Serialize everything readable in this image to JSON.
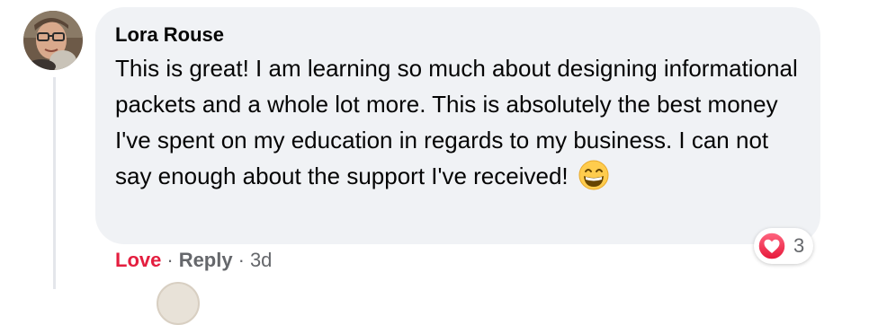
{
  "comment": {
    "author": "Lora Rouse",
    "text": "This is great! I am learning so much about designing informational packets and a whole lot more. This is absolutely the best money I've spent on my education in regards to my business. I can not say enough about the support I've received!",
    "emoji_icon": "grinning-face-with-smiling-eyes-icon",
    "actions": {
      "love_label": "Love",
      "separator": "·",
      "reply_label": "Reply",
      "time": "3d"
    },
    "reactions": {
      "icon": "heart-icon",
      "count": "3"
    }
  },
  "colors": {
    "bubble": "#f0f2f5",
    "love": "#e41e3f",
    "muted": "#65676b",
    "text": "#050505"
  }
}
